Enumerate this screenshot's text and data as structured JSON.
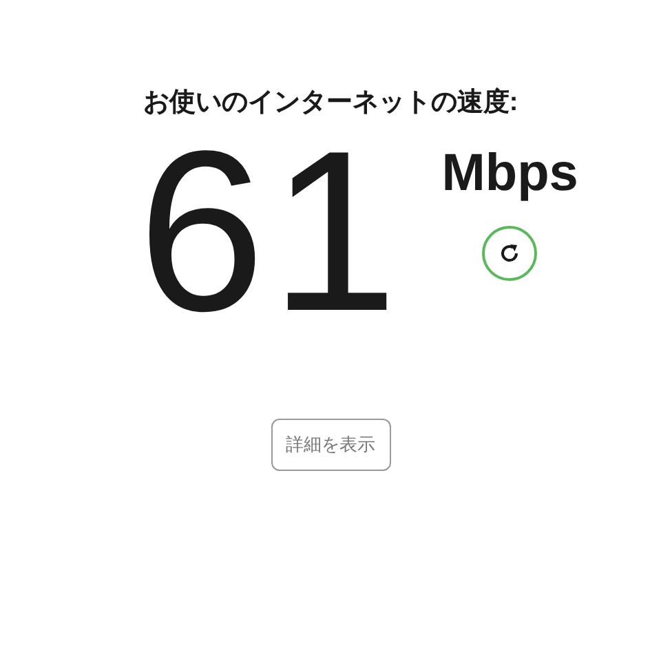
{
  "heading": "お使いのインターネットの速度:",
  "speed": {
    "value": "61",
    "unit": "Mbps"
  },
  "details_button": {
    "label": "詳細を表示"
  }
}
